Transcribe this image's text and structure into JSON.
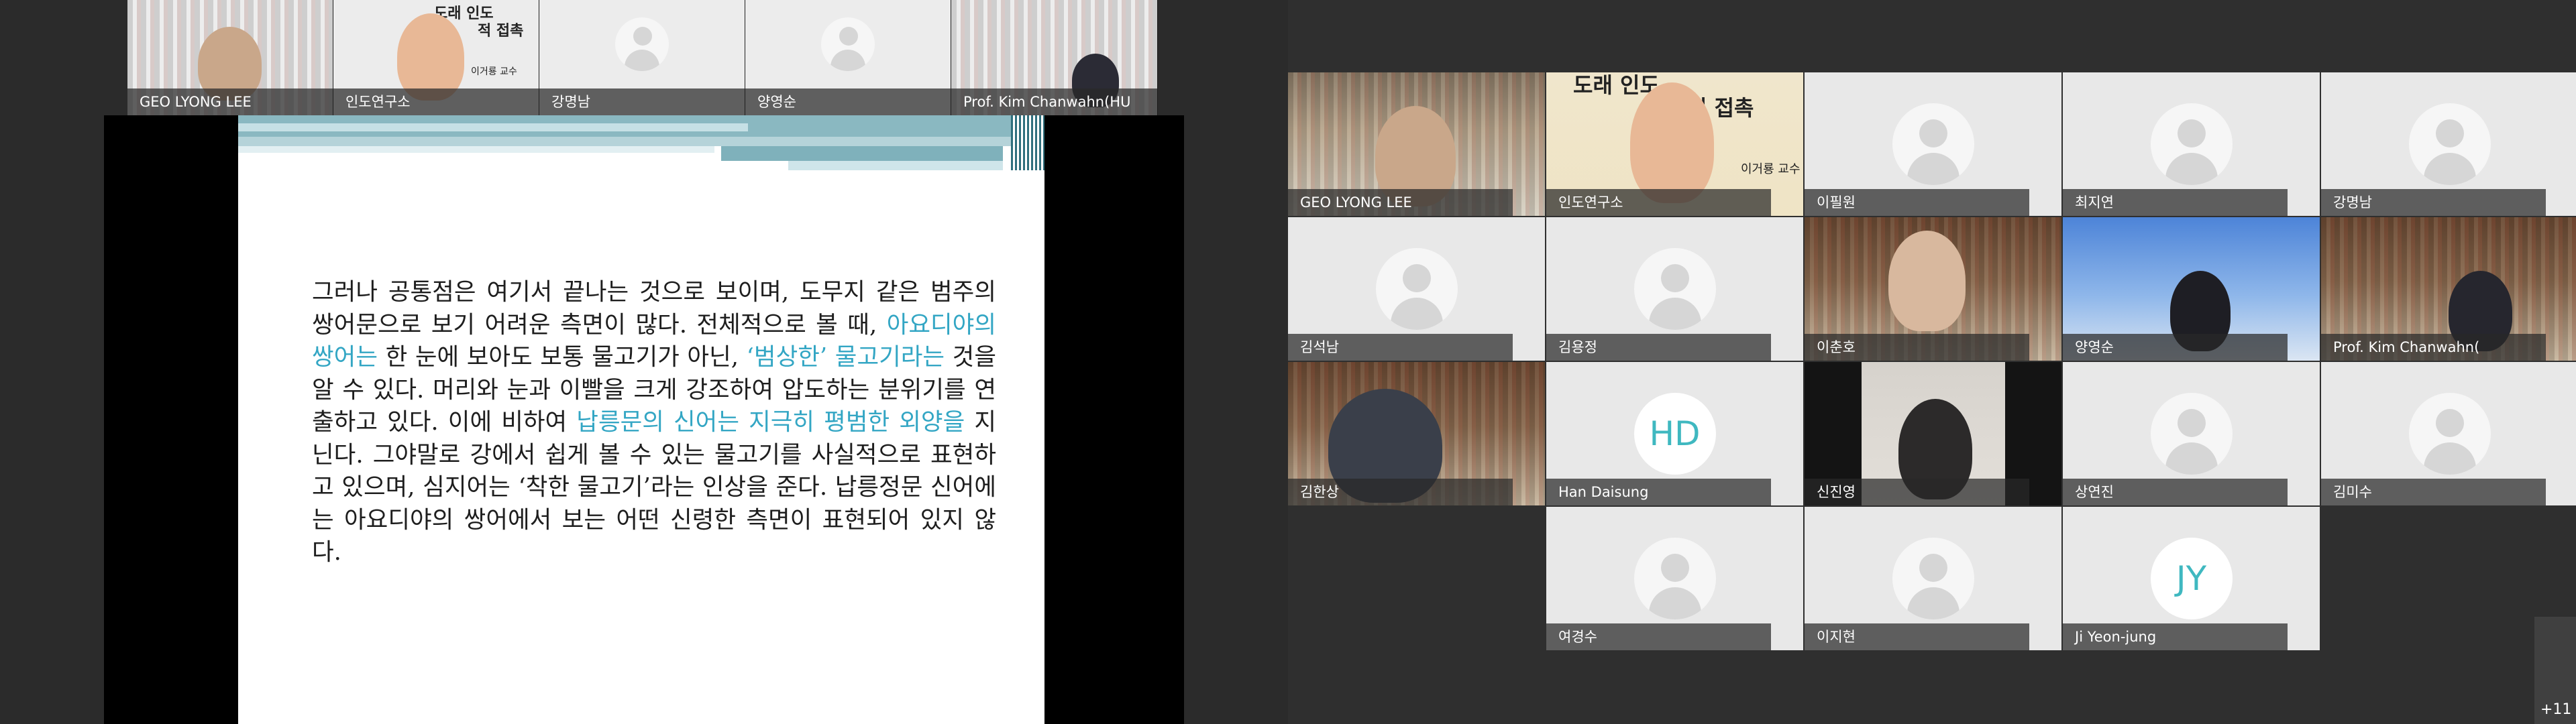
{
  "left_screen": {
    "strip": [
      {
        "name": "GEO LYONG LEE",
        "kind": "video-office"
      },
      {
        "name": "인도연구소",
        "kind": "video-poster"
      },
      {
        "name": "강명남",
        "kind": "avatar"
      },
      {
        "name": "양영순",
        "kind": "avatar"
      },
      {
        "name": "Prof. Kim Chanwahn(HU",
        "kind": "video-shelf"
      }
    ],
    "slide": {
      "poster_lines": [
        "도래 인도",
        "적 접촉",
        "이거룡 교수"
      ],
      "paragraph": [
        {
          "text": "그러나 공통점은 여기서 끝나는 것으로 보이며, 도무지 같은 범주의 쌍어문으로 보기 어려운 측면이 많다. 전체적으로 볼 때, ",
          "highlight": false
        },
        {
          "text": "아요디야의 쌍어는",
          "highlight": true
        },
        {
          "text": " 한 눈에 보아도 보통 물고기가 아닌, ",
          "highlight": false
        },
        {
          "text": "‘범상한’ 물고기라는",
          "highlight": true
        },
        {
          "text": " 것을 알 수 있다. 머리와 눈과 이빨을 크게 강조하여 압도하는 분위기를 연출하고 있다. 이에 비하여 ",
          "highlight": false
        },
        {
          "text": "납릉문의 신어는 지극히 평범한 외양을",
          "highlight": true
        },
        {
          "text": " 지닌다. 그야말로 강에서 쉽게 볼 수 있는 물고기를 사실적으로 표현하고 있으며, 심지어는 ‘착한 물고기’라는 인상을 준다. 납릉정문 신어에는 아요디야의 쌍어에서 보는 어떤 신령한 측면이 표현되어 있지 않다.",
          "highlight": false
        }
      ]
    }
  },
  "right_screen": {
    "tiles": [
      {
        "name": "GEO LYONG LEE",
        "kind": "video-office"
      },
      {
        "name": "인도연구소",
        "kind": "video-poster"
      },
      {
        "name": "이필원",
        "kind": "avatar"
      },
      {
        "name": "최지연",
        "kind": "avatar"
      },
      {
        "name": "강명남",
        "kind": "avatar"
      },
      {
        "name": "김석남",
        "kind": "avatar"
      },
      {
        "name": "김용정",
        "kind": "avatar"
      },
      {
        "name": "이춘호",
        "kind": "video-shelf"
      },
      {
        "name": "양영순",
        "kind": "video-sky"
      },
      {
        "name": "Prof. Kim Chanwahn(",
        "kind": "video-shelf"
      },
      {
        "name": "김한상",
        "kind": "video-shelf"
      },
      {
        "name": "Han Daisung",
        "kind": "initials",
        "initials": "HD"
      },
      {
        "name": "신진영",
        "kind": "video-dark"
      },
      {
        "name": "상연진",
        "kind": "avatar"
      },
      {
        "name": "김미수",
        "kind": "avatar"
      },
      {
        "name": "여경수",
        "kind": "avatar"
      },
      {
        "name": "이지현",
        "kind": "avatar"
      },
      {
        "name": "Ji Yeon-jung",
        "kind": "initials",
        "initials": "JY"
      }
    ],
    "more_count": "+11"
  },
  "colors": {
    "highlight_text": "#33a6c4",
    "initials_text": "#3fb8c0",
    "slide_teal": "#8ab8c1"
  }
}
